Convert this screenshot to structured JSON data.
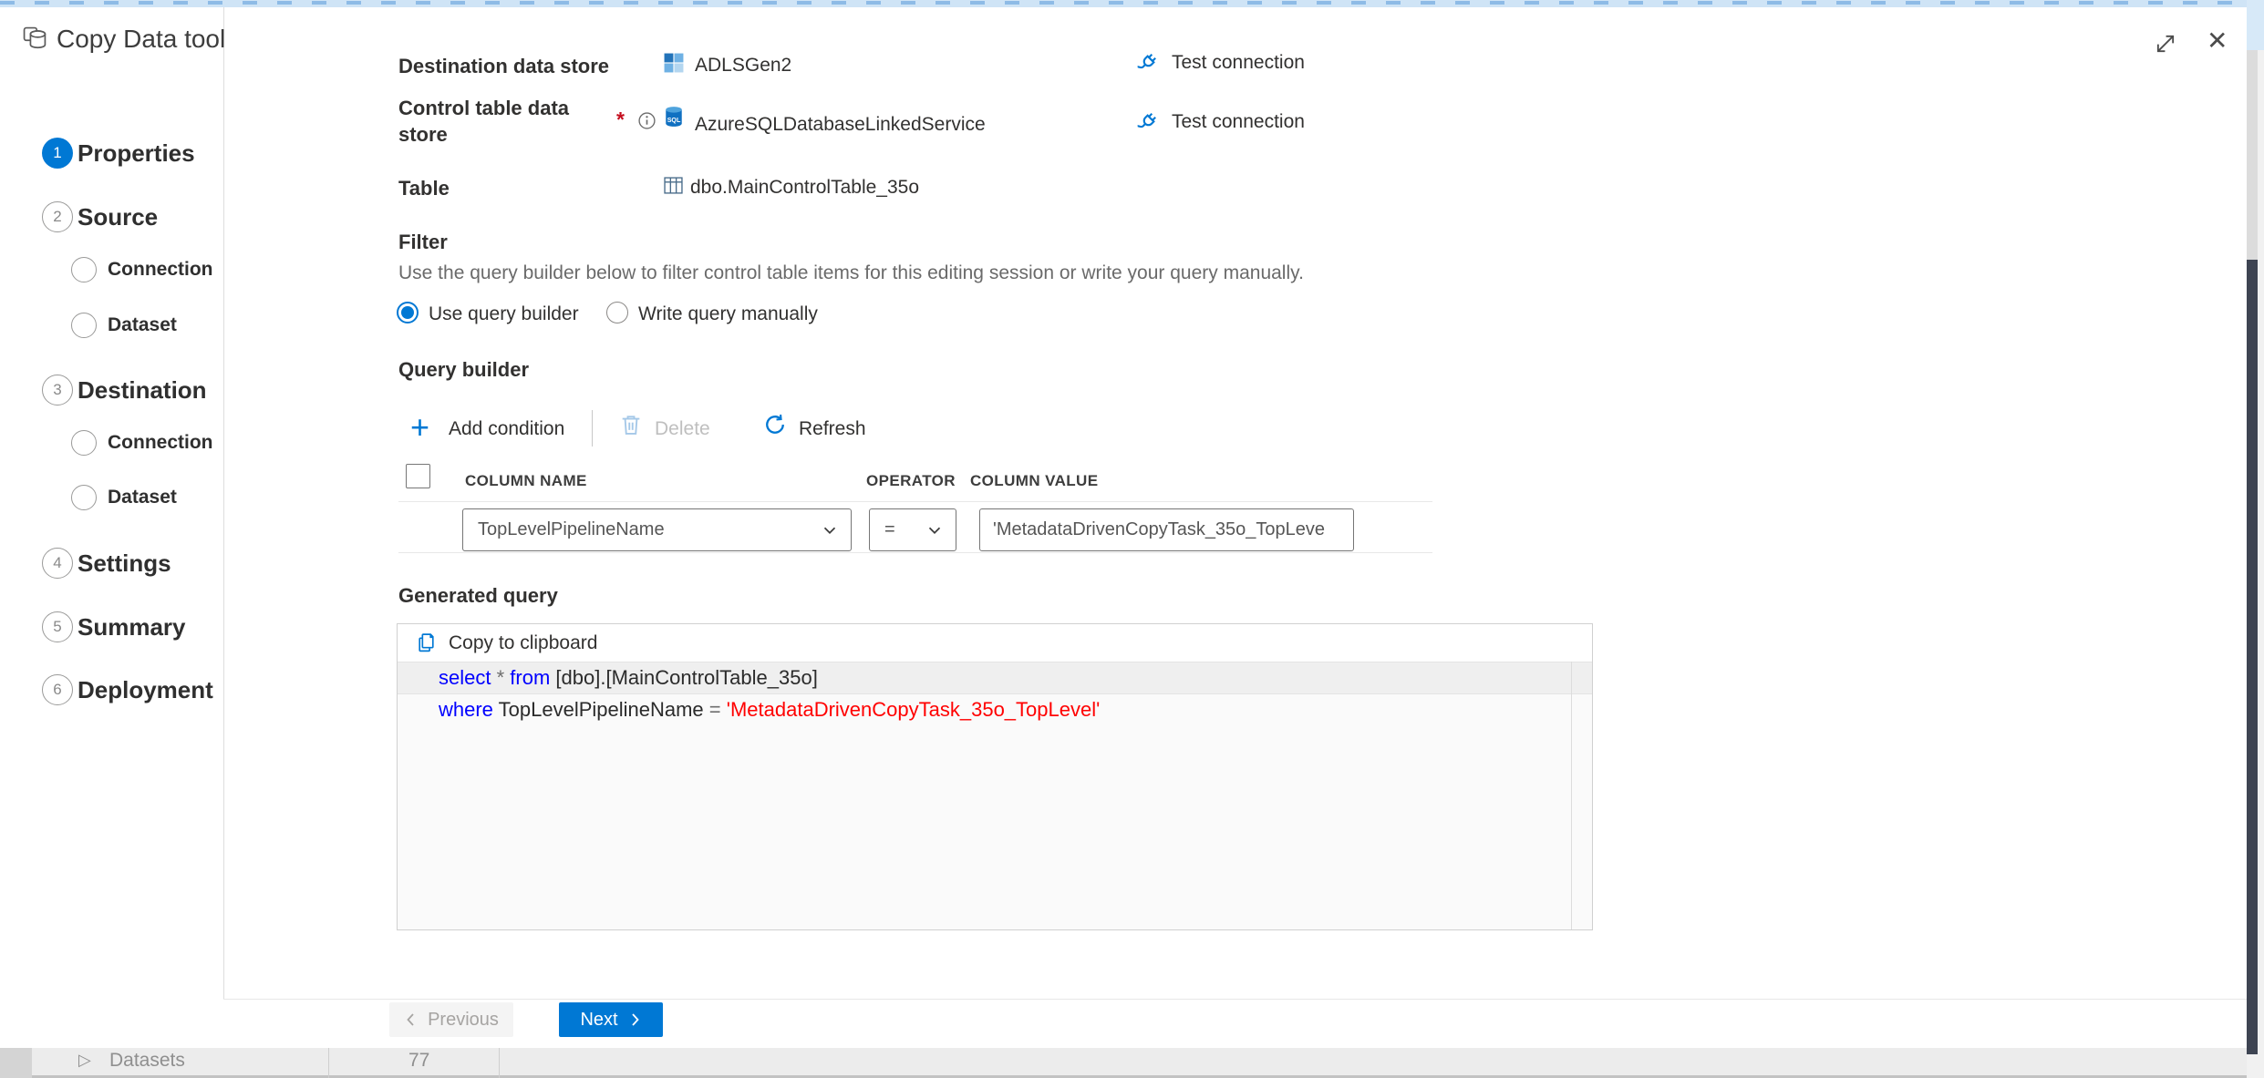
{
  "colors": {
    "accent": "#0078d4",
    "sql_keyword": "#0000ff",
    "sql_string": "#ff0000",
    "sql_operator": "#6e6e6e",
    "required_red": "#c50f1f"
  },
  "window": {
    "title": "Copy Data tool",
    "icons": [
      "copy-data-tool-icon",
      "expand-icon",
      "close-icon"
    ]
  },
  "sidebar": {
    "steps": [
      {
        "number": "1",
        "label": "Properties",
        "state": "active"
      },
      {
        "number": "2",
        "label": "Source",
        "state": "pending"
      },
      {
        "number": "3",
        "label": "Destination",
        "state": "pending"
      },
      {
        "number": "4",
        "label": "Settings",
        "state": "pending"
      },
      {
        "number": "5",
        "label": "Summary",
        "state": "pending"
      },
      {
        "number": "6",
        "label": "Deployment",
        "state": "pending"
      }
    ],
    "source_children": [
      {
        "label": "Connection"
      },
      {
        "label": "Dataset"
      }
    ],
    "destination_children": [
      {
        "label": "Connection"
      },
      {
        "label": "Dataset"
      }
    ]
  },
  "form": {
    "destination": {
      "label": "Destination data store",
      "icon": "adls-gen2-icon",
      "value": "ADLSGen2",
      "action": "Test connection"
    },
    "control_table": {
      "label": "Control table data store",
      "required": "*",
      "icon": "sql-database-icon",
      "value": "AzureSQLDatabaseLinkedService",
      "action": "Test connection"
    },
    "table": {
      "label": "Table",
      "icon": "table-icon",
      "value": "dbo.MainControlTable_35o"
    }
  },
  "filter": {
    "title": "Filter",
    "description": "Use the query builder below to filter control table items for this editing session or write your query manually.",
    "option_builder": "Use query builder",
    "option_manual": "Write query manually",
    "selected_option": "Use query builder"
  },
  "query_builder": {
    "title": "Query builder",
    "add_condition": "Add condition",
    "delete": "Delete",
    "refresh": "Refresh",
    "columns": {
      "name": "COLUMN NAME",
      "operator": "OPERATOR",
      "value": "COLUMN VALUE"
    },
    "condition": {
      "column_name": "TopLevelPipelineName",
      "operator": "=",
      "column_value": "'MetadataDrivenCopyTask_35o_TopLeve"
    }
  },
  "generated_query": {
    "title": "Generated query",
    "copy_label": "Copy to clipboard",
    "sql_lines": [
      [
        {
          "text": "select",
          "type": "keyword"
        },
        {
          "text": " ",
          "type": "plain"
        },
        {
          "text": "*",
          "type": "operator"
        },
        {
          "text": " ",
          "type": "plain"
        },
        {
          "text": "from",
          "type": "keyword"
        },
        {
          "text": " [dbo].[MainControlTable_35o]",
          "type": "plain"
        }
      ],
      [
        {
          "text": "where",
          "type": "keyword"
        },
        {
          "text": " TopLevelPipelineName ",
          "type": "plain"
        },
        {
          "text": "=",
          "type": "operator"
        },
        {
          "text": " ",
          "type": "plain"
        },
        {
          "text": "'MetadataDrivenCopyTask_35o_TopLevel'",
          "type": "string"
        }
      ]
    ]
  },
  "footer": {
    "previous": "Previous",
    "next": "Next"
  },
  "background_page": {
    "tree_item": "Datasets",
    "tree_item_count": "77"
  }
}
